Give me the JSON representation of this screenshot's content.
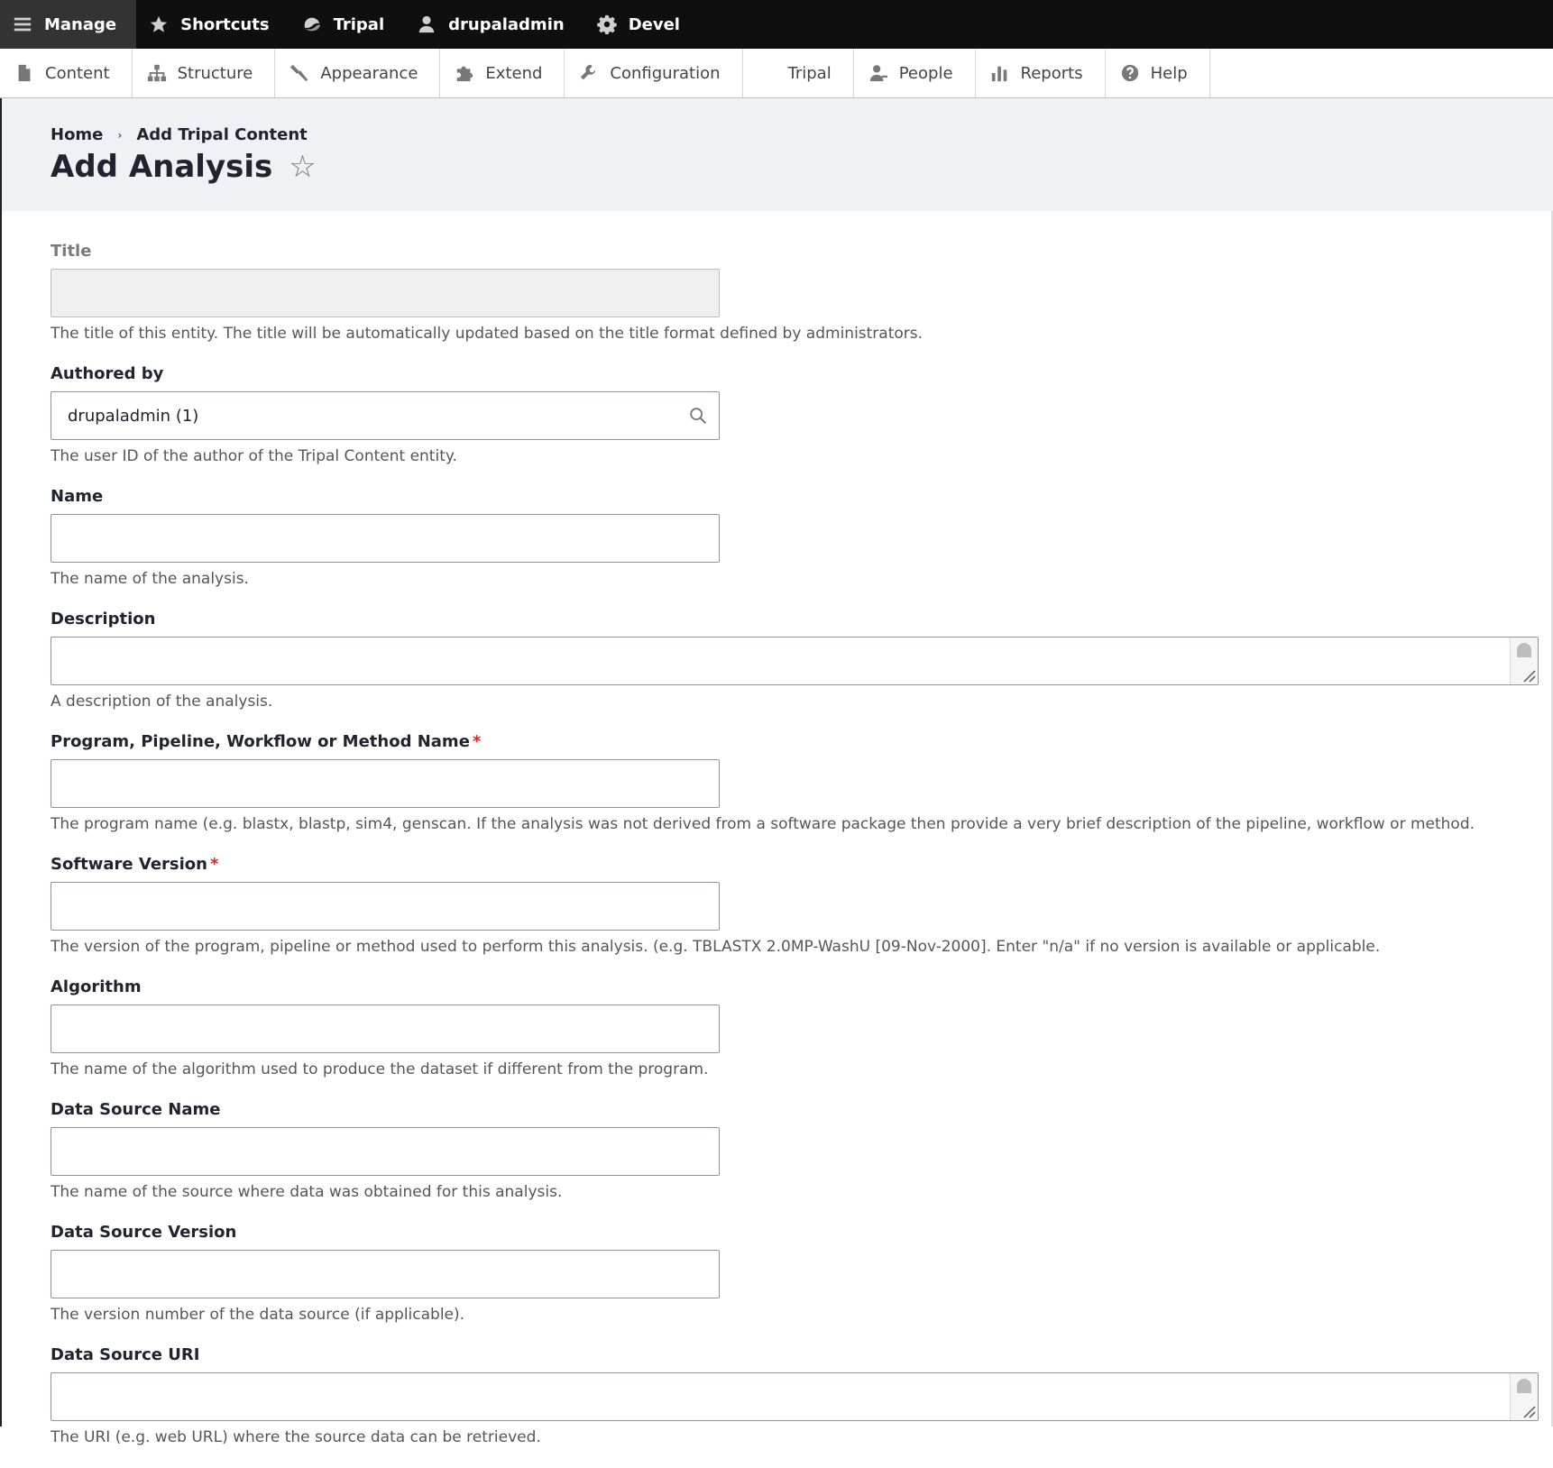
{
  "toolbar": {
    "items": [
      {
        "label": "Manage",
        "icon": "menu-icon"
      },
      {
        "label": "Shortcuts",
        "icon": "star-icon"
      },
      {
        "label": "Tripal",
        "icon": "tripal-icon"
      },
      {
        "label": "drupaladmin",
        "icon": "user-icon"
      },
      {
        "label": "Devel",
        "icon": "gear-icon"
      }
    ]
  },
  "tray": {
    "items": [
      {
        "label": "Content",
        "icon": "file-icon"
      },
      {
        "label": "Structure",
        "icon": "sitemap-icon"
      },
      {
        "label": "Appearance",
        "icon": "paintbrush-icon"
      },
      {
        "label": "Extend",
        "icon": "puzzle-icon"
      },
      {
        "label": "Configuration",
        "icon": "wrench-icon"
      },
      {
        "label": "Tripal",
        "icon": ""
      },
      {
        "label": "People",
        "icon": "people-icon"
      },
      {
        "label": "Reports",
        "icon": "bar-chart-icon"
      },
      {
        "label": "Help",
        "icon": "help-icon"
      }
    ]
  },
  "breadcrumb": {
    "home": "Home",
    "separator": "›",
    "current": "Add Tripal Content"
  },
  "page": {
    "title": "Add Analysis",
    "star": "☆"
  },
  "form": {
    "title": {
      "label": "Title",
      "value": "",
      "description": "The title of this entity. The title will be automatically updated based on the title format defined by administrators."
    },
    "authored_by": {
      "label": "Authored by",
      "value": "drupaladmin (1)",
      "description": "The user ID of the author of the Tripal Content entity."
    },
    "name": {
      "label": "Name",
      "value": "",
      "description": "The name of the analysis."
    },
    "description": {
      "label": "Description",
      "value": "",
      "description": "A description of the analysis."
    },
    "program": {
      "label": "Program, Pipeline, Workflow or Method Name",
      "required": "*",
      "value": "",
      "description": "The program name (e.g. blastx, blastp, sim4, genscan. If the analysis was not derived from a software package then provide a very brief description of the pipeline, workflow or method."
    },
    "software_version": {
      "label": "Software Version",
      "required": "*",
      "value": "",
      "description": "The version of the program, pipeline or method used to perform this analysis. (e.g. TBLASTX 2.0MP-WashU [09-Nov-2000]. Enter \"n/a\" if no version is available or applicable."
    },
    "algorithm": {
      "label": "Algorithm",
      "value": "",
      "description": "The name of the algorithm used to produce the dataset if different from the program."
    },
    "data_source_name": {
      "label": "Data Source Name",
      "value": "",
      "description": "The name of the source where data was obtained for this analysis."
    },
    "data_source_version": {
      "label": "Data Source Version",
      "value": "",
      "description": "The version number of the data source (if applicable)."
    },
    "data_source_uri": {
      "label": "Data Source URI",
      "value": "",
      "description": "The URI (e.g. web URL) where the source data can be retrieved."
    }
  },
  "colors": {
    "toolbar_bg": "#0f0f0f",
    "toolbar_active": "#333333",
    "header_bg": "#f0f1f5",
    "required": "#dc2323"
  }
}
